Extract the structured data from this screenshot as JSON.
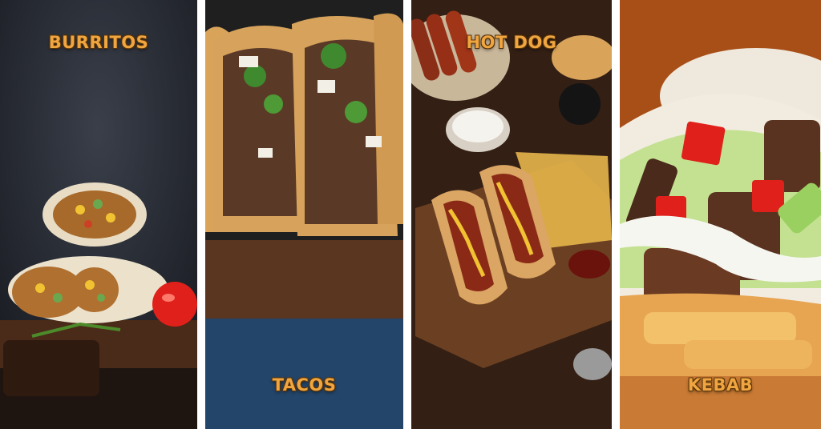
{
  "panels": [
    {
      "label": "BURRITOS"
    },
    {
      "label": "TACOS"
    },
    {
      "label": "HOT DOG"
    },
    {
      "label": "KEBAB"
    }
  ],
  "colors": {
    "label_text": "#f0a640",
    "label_outline": "#5a3308",
    "divider": "#ffffff"
  }
}
